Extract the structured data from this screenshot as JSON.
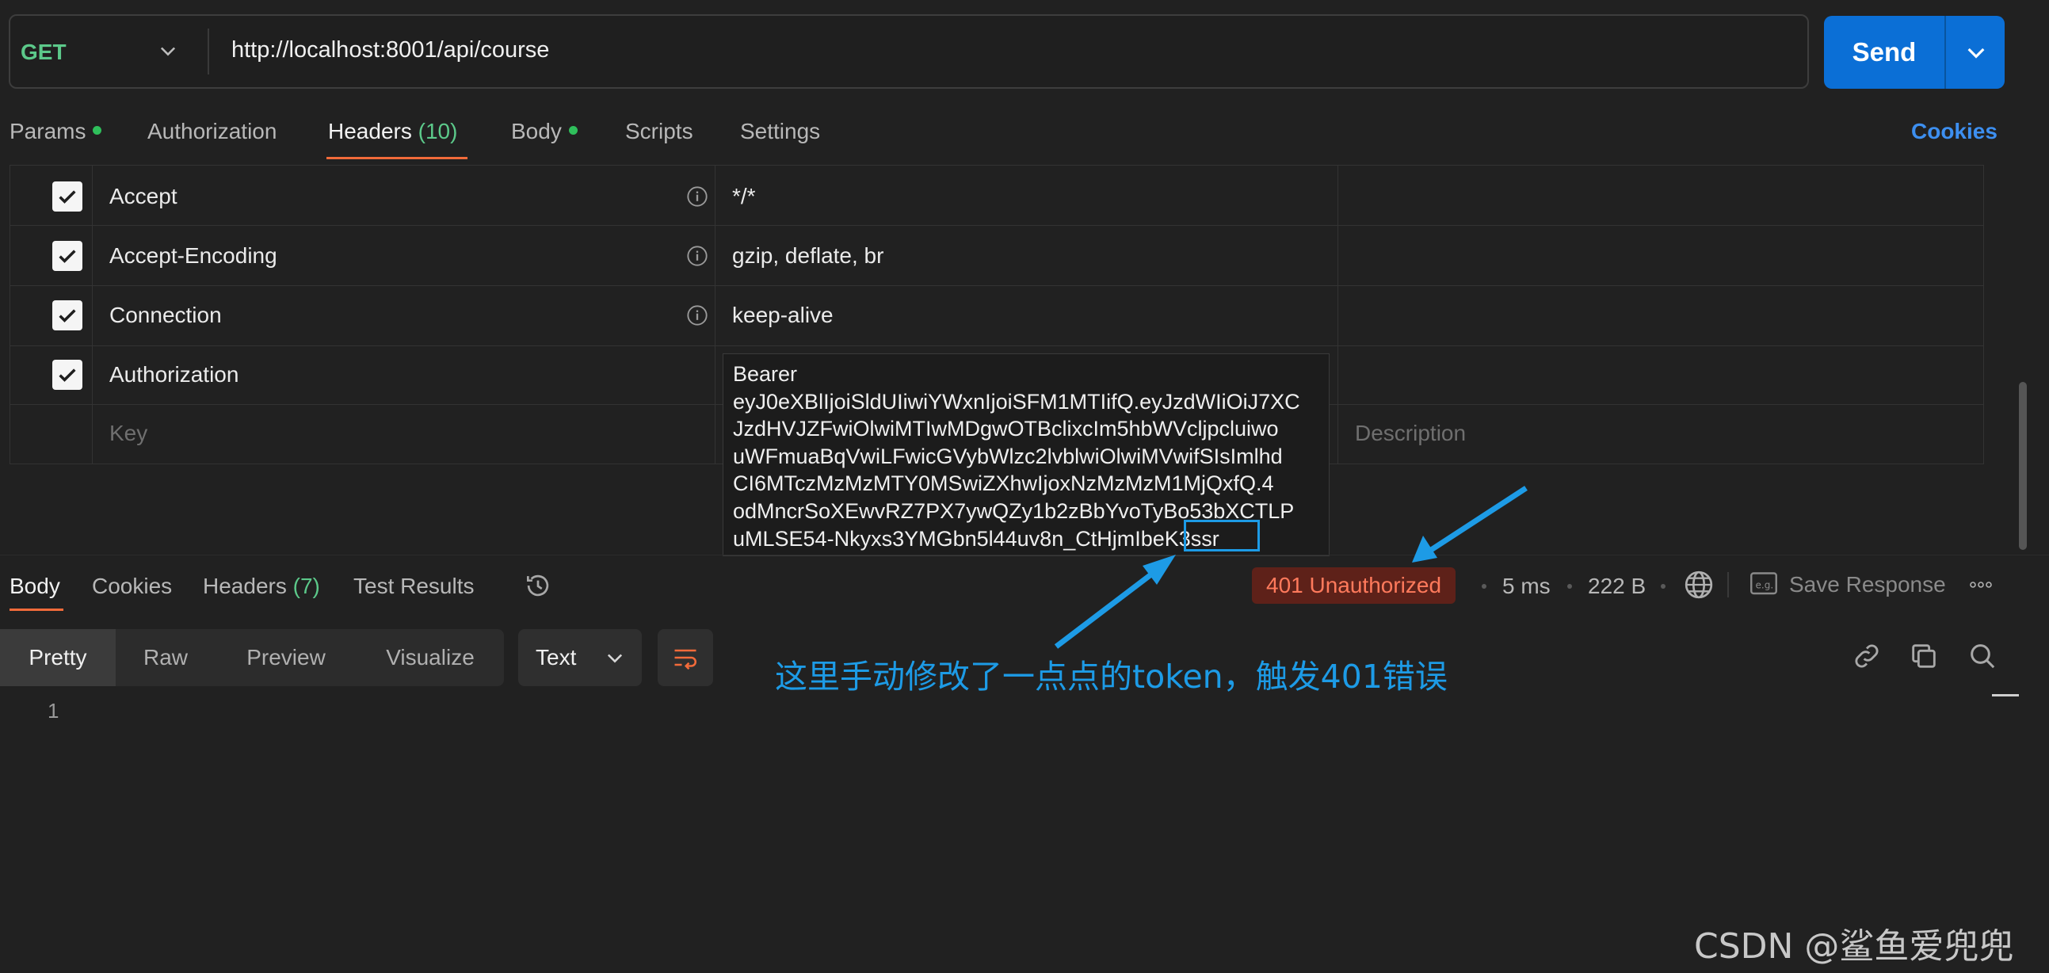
{
  "request": {
    "method": "GET",
    "url": "http://localhost:8001/api/course",
    "send_label": "Send"
  },
  "request_tabs": [
    {
      "label": "Params",
      "has_dot": true
    },
    {
      "label": "Authorization"
    },
    {
      "label": "Headers",
      "count": "(10)",
      "active": true
    },
    {
      "label": "Body",
      "has_dot": true
    },
    {
      "label": "Scripts"
    },
    {
      "label": "Settings"
    }
  ],
  "cookies_label": "Cookies",
  "headers_table": {
    "rows": [
      {
        "key": "Accept",
        "value": "*/*",
        "checked": true,
        "info": true
      },
      {
        "key": "Accept-Encoding",
        "value": "gzip, deflate, br",
        "checked": true,
        "info": true
      },
      {
        "key": "Connection",
        "value": "keep-alive",
        "checked": true,
        "info": true
      },
      {
        "key": "Authorization",
        "checked": true
      }
    ],
    "auth_value_lines": [
      "Bearer",
      "eyJ0eXBlIjoiSldUIiwiYWxnIjoiSFM1MTIifQ.eyJzdWIiOiJ7XC",
      "JzdHVJZFwiOlwiMTIwMDgwOTBclixcIm5hbWVcljpcluiwo",
      "uWFmuaBqVwiLFwicGVybWlzc2lvblwiOlwiMVwifSIsImlhd",
      "CI6MTczMzMzMTY0MSwiZXhwIjoxNzMzMzM1MjQxfQ.4",
      "odMncrSoXEwvRZ7PX7ywQZy1b2zBbYvoTyBo53bXCTLP",
      "uMLSE54-Nkyxs3YMGbn5l44uv8n_CtHjmIbeK3ssr"
    ],
    "key_placeholder": "Key",
    "description_placeholder": "Description"
  },
  "response_tabs": [
    {
      "label": "Body",
      "active": true
    },
    {
      "label": "Cookies"
    },
    {
      "label": "Headers",
      "count": "(7)"
    },
    {
      "label": "Test Results"
    }
  ],
  "response_meta": {
    "status": "401 Unauthorized",
    "time": "5 ms",
    "size": "222 B",
    "save_response": "Save Response"
  },
  "view_modes": [
    "Pretty",
    "Raw",
    "Preview",
    "Visualize"
  ],
  "format": "Text",
  "editor": {
    "line_number": "1"
  },
  "annotation": "这里手动修改了一点点的token，触发401错误",
  "watermark": "CSDN @鲨鱼爱兜兜",
  "colors": {
    "accent_blue": "#0b6fd6",
    "status_error": "#ff7a5c",
    "tab_active": "#f26b3a",
    "annotation": "#1d9be6"
  }
}
